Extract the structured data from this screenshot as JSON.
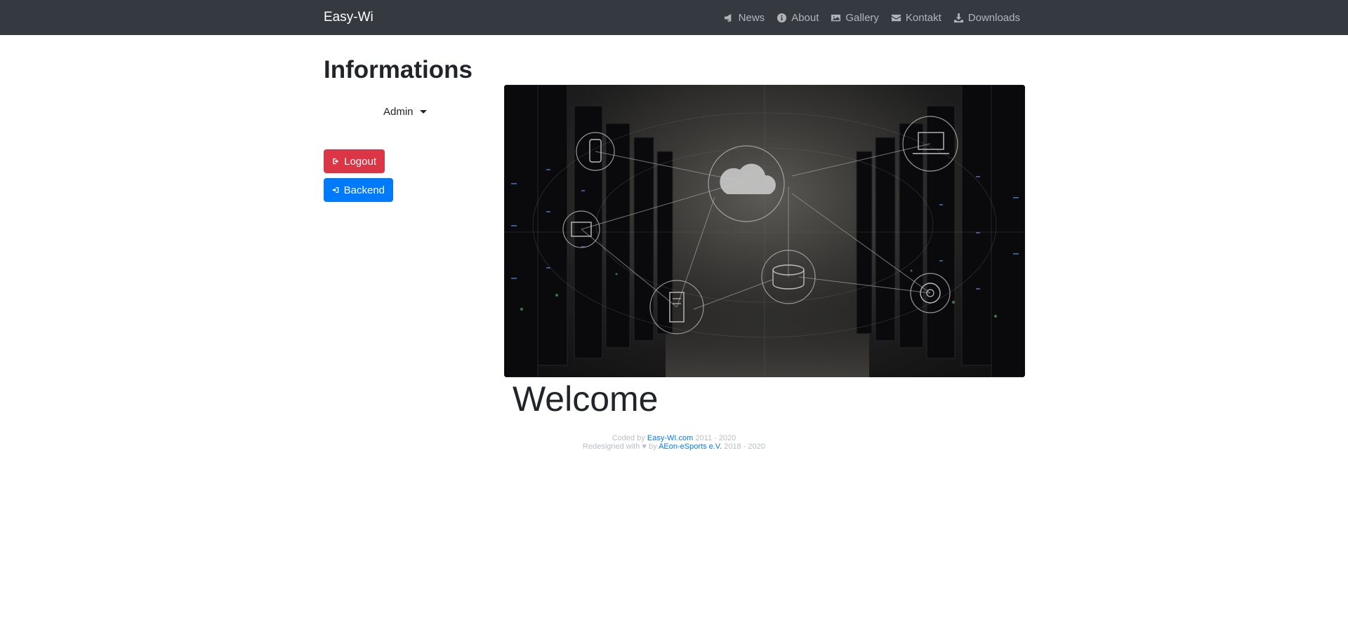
{
  "navbar": {
    "brand": "Easy-Wi",
    "items": [
      {
        "label": "News",
        "icon": "bullhorn-icon"
      },
      {
        "label": "About",
        "icon": "info-circle-icon"
      },
      {
        "label": "Gallery",
        "icon": "image-icon"
      },
      {
        "label": "Kontakt",
        "icon": "envelope-icon"
      },
      {
        "label": "Downloads",
        "icon": "download-icon"
      }
    ]
  },
  "sidebar": {
    "title": "Informations",
    "user_menu": "Admin",
    "logout_label": "Logout",
    "backend_label": "Backend"
  },
  "main": {
    "hero_image": "server-room-cloud-network-image",
    "welcome": "Welcome"
  },
  "footer": {
    "line1_prefix": "Coded by",
    "line1_link": "Easy-WI.com",
    "line1_years": "2011 - 2020",
    "line2_prefix": "Redesigned with",
    "line2_heart": "♥",
    "line2_by": "by",
    "line2_link": "AEon-eSports e.V.",
    "line2_years": "2018 - 2020"
  },
  "colors": {
    "navbar_bg": "#343a40",
    "danger": "#dc3545",
    "primary": "#007bff",
    "link": "#007bff",
    "footer_text": "#b9bec3"
  }
}
